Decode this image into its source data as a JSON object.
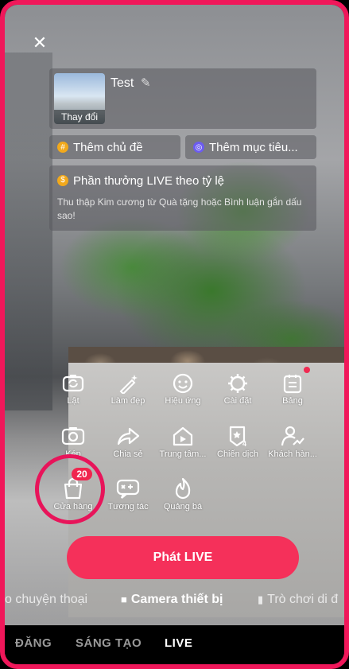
{
  "setup": {
    "close_icon": "close-icon",
    "title": "Test",
    "cover_caption": "Thay đổi",
    "add_topic": "Thêm chủ đề",
    "add_goal": "Thêm mục tiêu...",
    "reward_title": "Phần thưởng LIVE theo tỷ lệ",
    "reward_desc": "Thu thập Kim cương từ Quà tặng hoặc Bình luận gắn dấu sao!"
  },
  "tools_row1": [
    {
      "label": "Lật",
      "icon": "flip-camera-icon"
    },
    {
      "label": "Làm đẹp",
      "icon": "beauty-wand-icon"
    },
    {
      "label": "Hiệu ứng",
      "icon": "effects-smiley-icon"
    },
    {
      "label": "Cài đặt",
      "icon": "settings-gear-icon"
    },
    {
      "label": "Bảng",
      "icon": "board-icon"
    }
  ],
  "tools_row2": [
    {
      "label": "Kép",
      "icon": "dual-camera-icon"
    },
    {
      "label": "Chia sẻ",
      "icon": "share-arrow-icon"
    },
    {
      "label": "Trung tâm...",
      "icon": "center-house-icon"
    },
    {
      "label": "Chiến dịch",
      "icon": "campaign-flag-icon"
    },
    {
      "label": "Khách hàn...",
      "icon": "customer-person-icon"
    }
  ],
  "tools_row3": [
    {
      "label": "Cửa hàng",
      "icon": "shopping-bag-icon",
      "badge": "20"
    },
    {
      "label": "Tương tác",
      "icon": "interaction-icon"
    },
    {
      "label": "Quảng bá",
      "icon": "promote-flame-icon"
    }
  ],
  "go_live_label": "Phát LIVE",
  "modes": [
    {
      "label": "Trò chuyện thoại",
      "visible_text": "o chuyện thoại"
    },
    {
      "label": "Camera thiết bị"
    },
    {
      "label": "Trò chơi di động",
      "visible_text": "Trò chơi di đ"
    }
  ],
  "bottom_tabs": [
    "ĐĂNG",
    "SÁNG TẠO",
    "LIVE"
  ],
  "colors": {
    "accent": "#f5305a",
    "ring": "#e8145a",
    "frame": "#f0175a"
  }
}
